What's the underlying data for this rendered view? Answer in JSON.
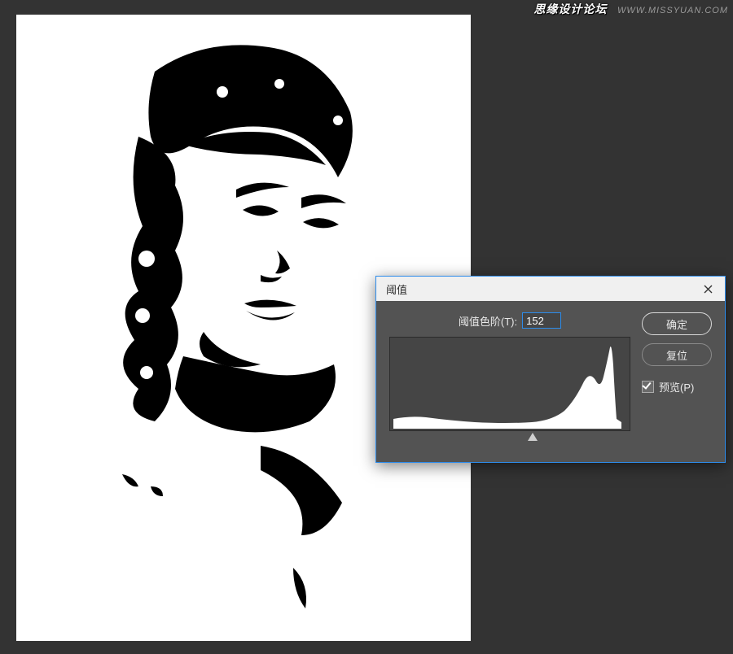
{
  "watermark": {
    "brand": "思缘设计论坛",
    "url": "WWW.MISSYUAN.COM"
  },
  "dialog": {
    "title": "阈值",
    "level_label": "阈值色阶(T):",
    "level_value": "152",
    "ok": "确定",
    "reset": "复位",
    "preview_label": "预览(P)",
    "preview_checked": true,
    "slider_pos_percent": 59.6
  }
}
